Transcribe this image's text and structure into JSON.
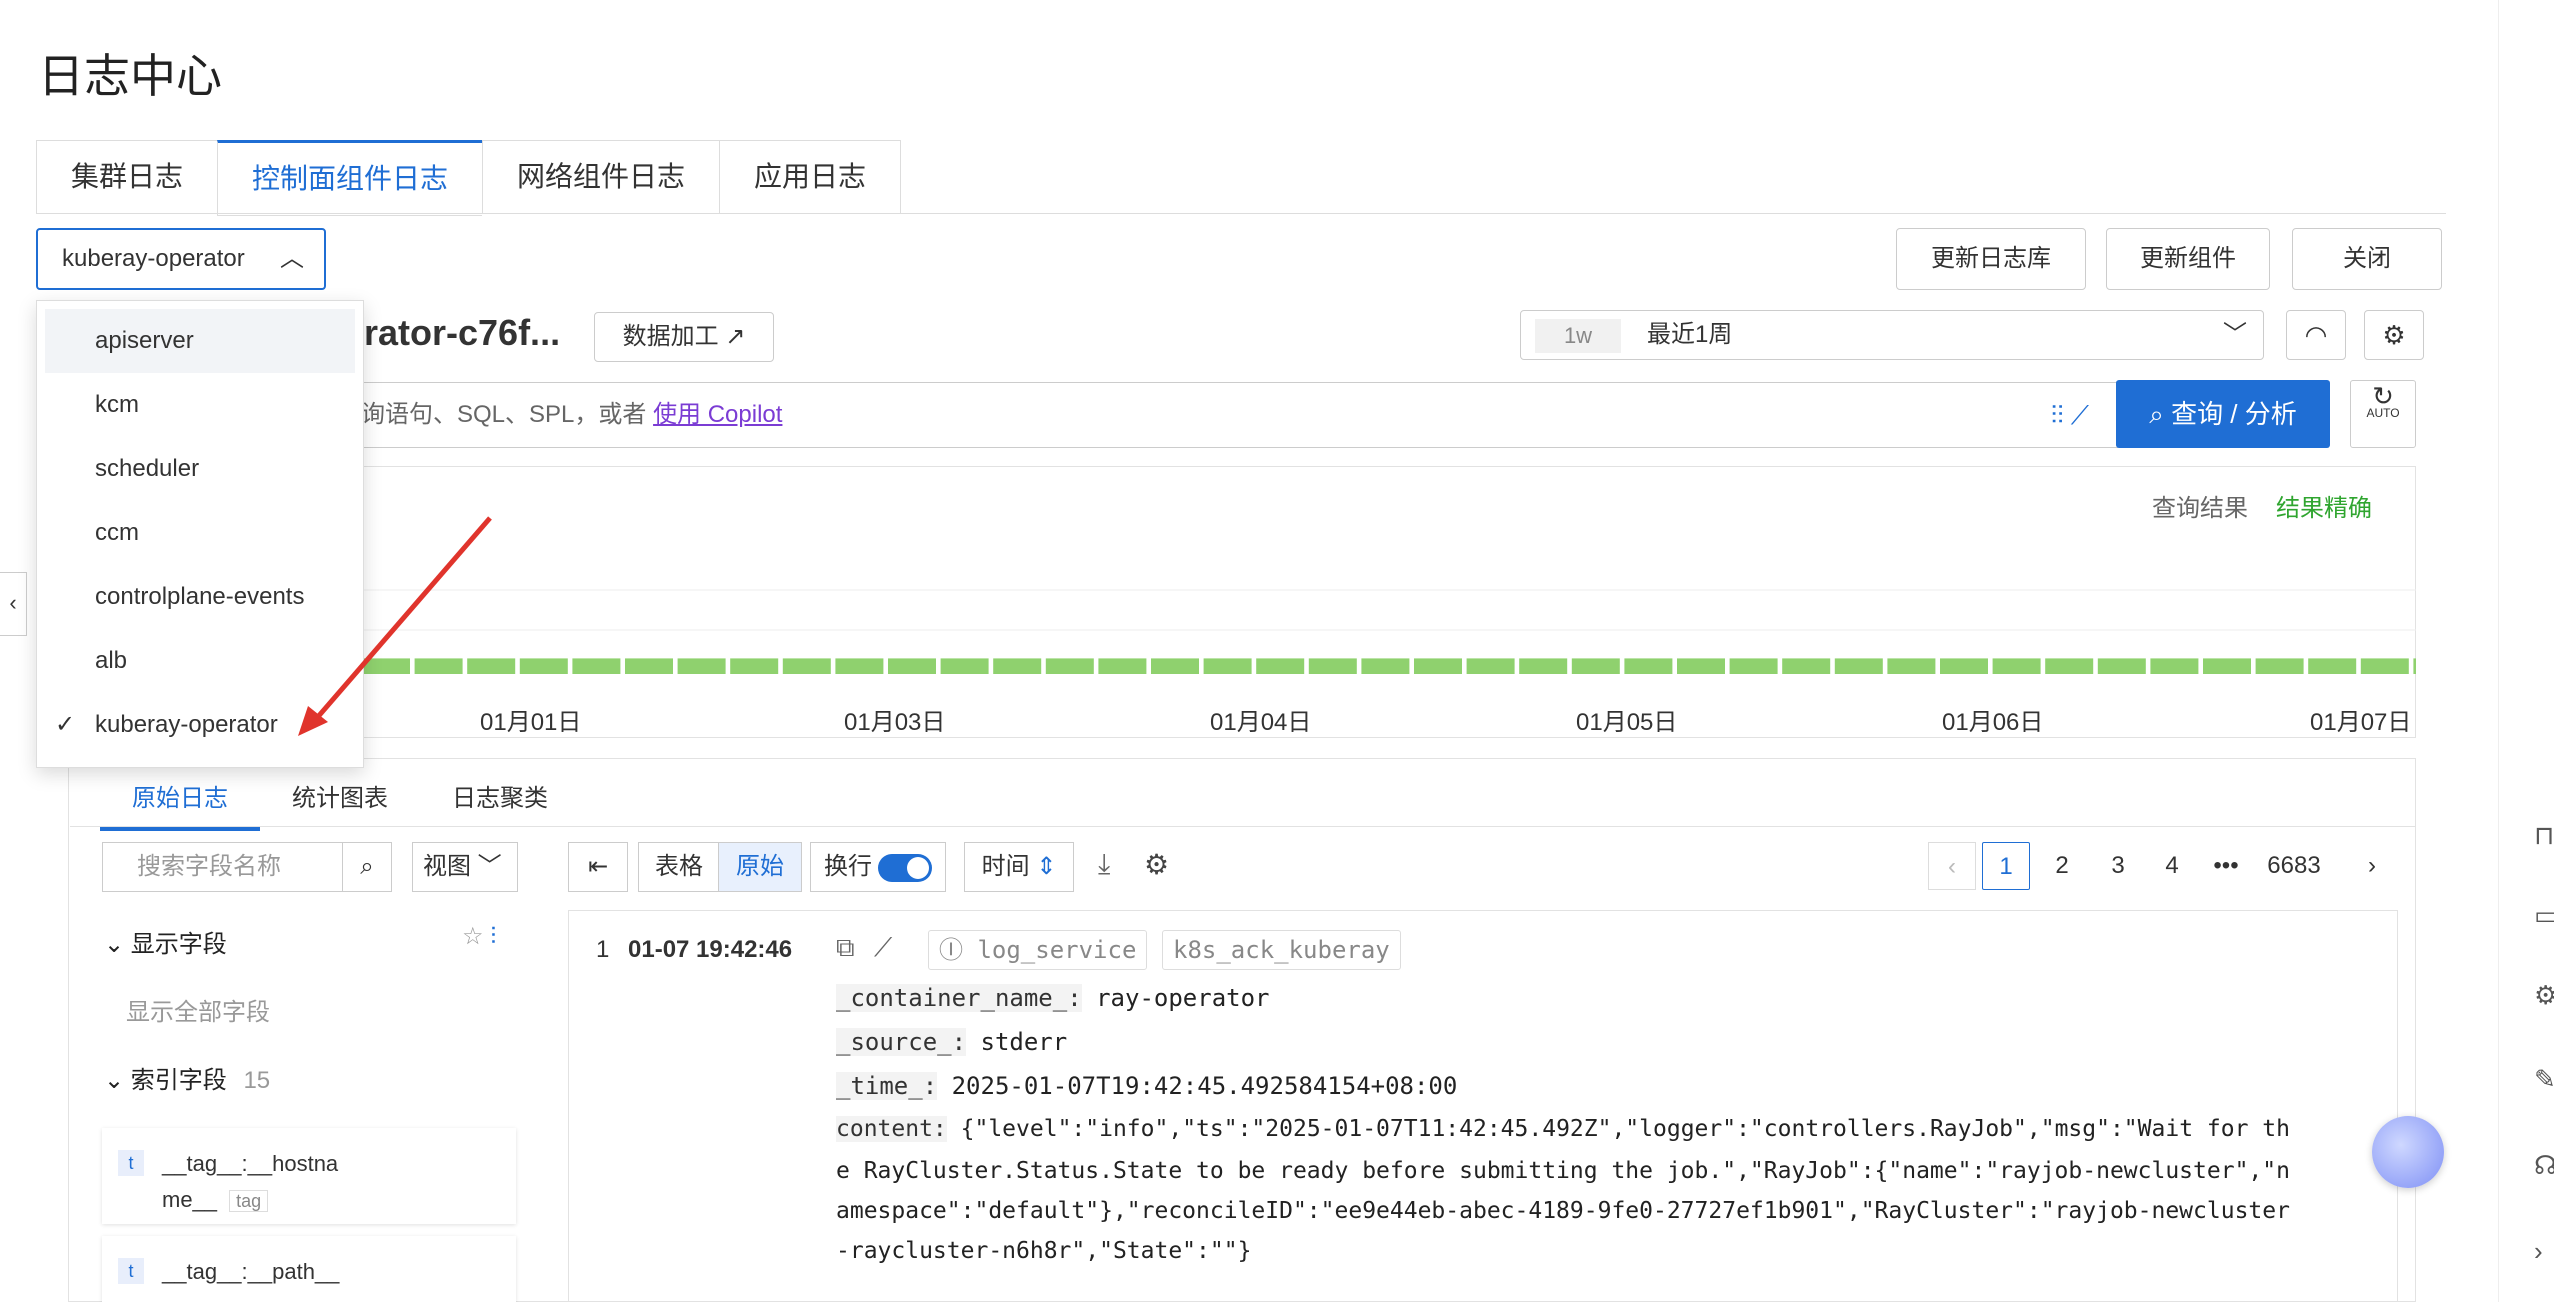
{
  "page_title": "日志中心",
  "tabs": [
    "集群日志",
    "控制面组件日志",
    "网络组件日志",
    "应用日志"
  ],
  "component_select": {
    "value": "kuberay-operator"
  },
  "header_buttons": [
    "更新日志库",
    "更新组件",
    "关闭"
  ],
  "dropdown": {
    "items": [
      "apiserver",
      "kcm",
      "scheduler",
      "ccm",
      "controlplane-events",
      "alb",
      "kuberay-operator"
    ],
    "check": "✓"
  },
  "logstore": {
    "title": "rator-c76f...",
    "process_button": "数据加工"
  },
  "time_range": {
    "short": "1w",
    "label": "最近1周"
  },
  "query": {
    "placeholder": "询语句、SQL、SPL，或者",
    "copilot_link": "使用 Copilot",
    "button": "查询 / 分析",
    "auto": "AUTO"
  },
  "chart": {
    "status_label": "查询结果",
    "status_value": "结果精确",
    "x_labels": [
      "01月01日",
      "01月03日",
      "01月04日",
      "01月05日",
      "01月06日",
      "01月07日"
    ]
  },
  "chart_data": {
    "type": "bar",
    "categories": [],
    "values": [
      3,
      3,
      3,
      3,
      3,
      3,
      3,
      3,
      3,
      3,
      3,
      3,
      3,
      3,
      3,
      3,
      3,
      3,
      3,
      3,
      3,
      3,
      3,
      3,
      3,
      3,
      3,
      3,
      3,
      3,
      3,
      3,
      3,
      3,
      3,
      3,
      3,
      3,
      3,
      3,
      18
    ],
    "xlabel": "",
    "ylabel": "",
    "grid": true
  },
  "result_tabs": [
    "原始日志",
    "统计图表",
    "日志聚类"
  ],
  "fields_panel": {
    "search_placeholder": "搜索字段名称",
    "view_label": "视图",
    "display_fields": "显示字段",
    "show_all": "显示全部字段",
    "index_fields": "索引字段",
    "index_count": "15",
    "field1": "__tag__:__hostna",
    "field1b": "me__",
    "field1_tag": "tag",
    "field2": "__tag__:__path__",
    "type_t": "t"
  },
  "toolbar": {
    "table": "表格",
    "raw": "原始",
    "wrap": "换行",
    "time": "时间"
  },
  "pager": {
    "pages": [
      "1",
      "2",
      "3",
      "4"
    ],
    "ellipsis": "•••",
    "last": "6683"
  },
  "log": {
    "index": "1",
    "time": "01-07 19:42:46",
    "chip1": "log_service",
    "chip2": "k8s_ack_kuberay",
    "lines": [
      {
        "k": "_container_name_:",
        "v": "ray-operator"
      },
      {
        "k": "_source_:",
        "v": "stderr"
      },
      {
        "k": "_time_:",
        "v": "2025-01-07T19:42:45.492584154+08:00"
      },
      {
        "k": "content:",
        "v": "{\"level\":\"info\",\"ts\":\"2025-01-07T11:42:45.492Z\",\"logger\":\"controllers.RayJob\",\"msg\":\"Wait for th"
      }
    ],
    "content_cont": [
      "e RayCluster.Status.State to be ready before submitting the job.\",\"RayJob\":{\"name\":\"rayjob-newcluster\",\"n",
      "amespace\":\"default\"},\"reconcileID\":\"ee9e44eb-abec-4189-9fe0-27727ef1b901\",\"RayCluster\":\"rayjob-newcluster",
      "-raycluster-n6h8r\",\"State\":\"\"}"
    ]
  }
}
